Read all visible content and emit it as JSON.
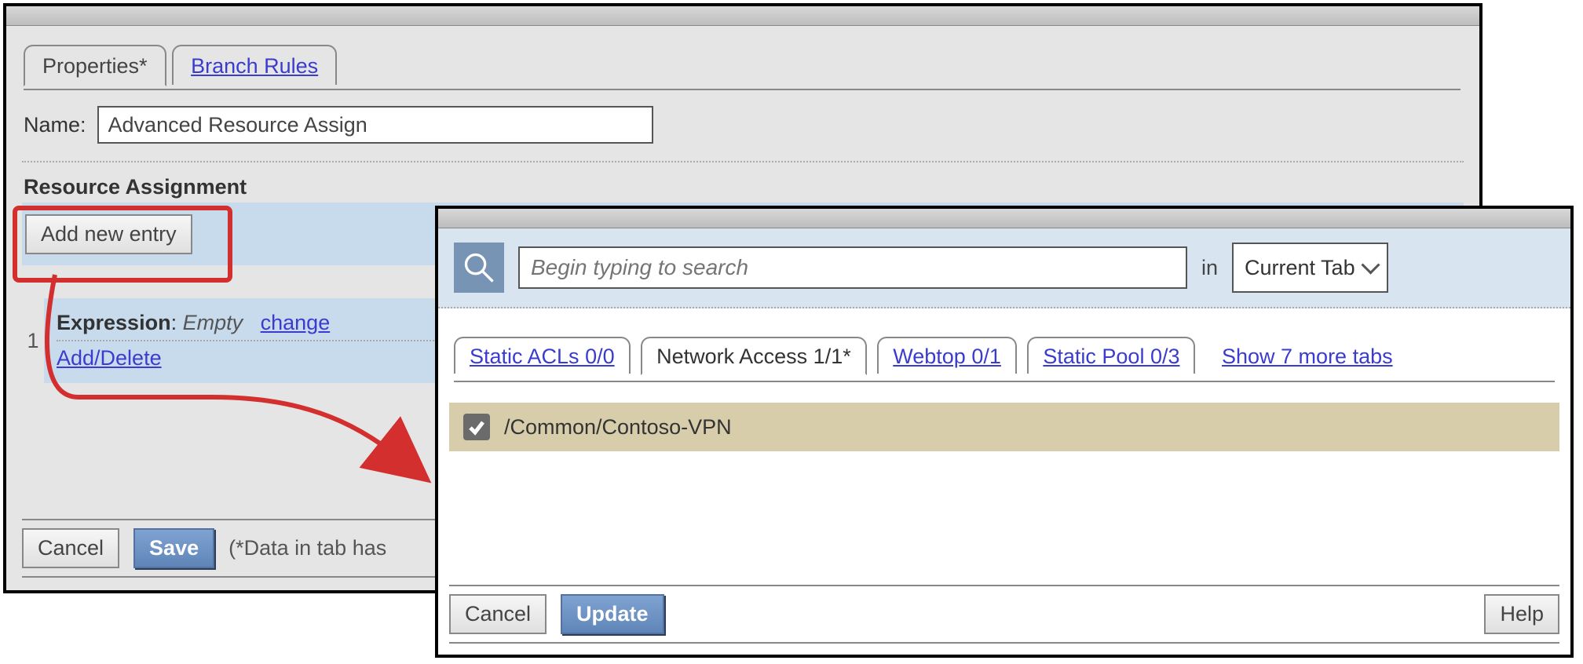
{
  "left": {
    "tabs": {
      "properties": "Properties*",
      "branch_rules": "Branch Rules"
    },
    "name_label": "Name:",
    "name_value": "Advanced Resource Assign",
    "section": "Resource Assignment",
    "add_entry": "Add new entry",
    "row_index": "1",
    "expr_label": "Expression",
    "expr_value": "Empty",
    "expr_change": "change",
    "add_delete": "Add/Delete",
    "cancel": "Cancel",
    "save": "Save",
    "note": "(*Data in tab has"
  },
  "right": {
    "search_placeholder": "Begin typing to search",
    "in": "in",
    "scope": "Current Tab",
    "tabs": {
      "static_acls": "Static ACLs 0/0",
      "network_access": "Network Access 1/1*",
      "webtop": "Webtop 0/1",
      "static_pool": "Static Pool 0/3"
    },
    "show_more": "Show 7 more tabs",
    "item_label": "/Common/Contoso-VPN",
    "cancel": "Cancel",
    "update": "Update",
    "help": "Help"
  }
}
